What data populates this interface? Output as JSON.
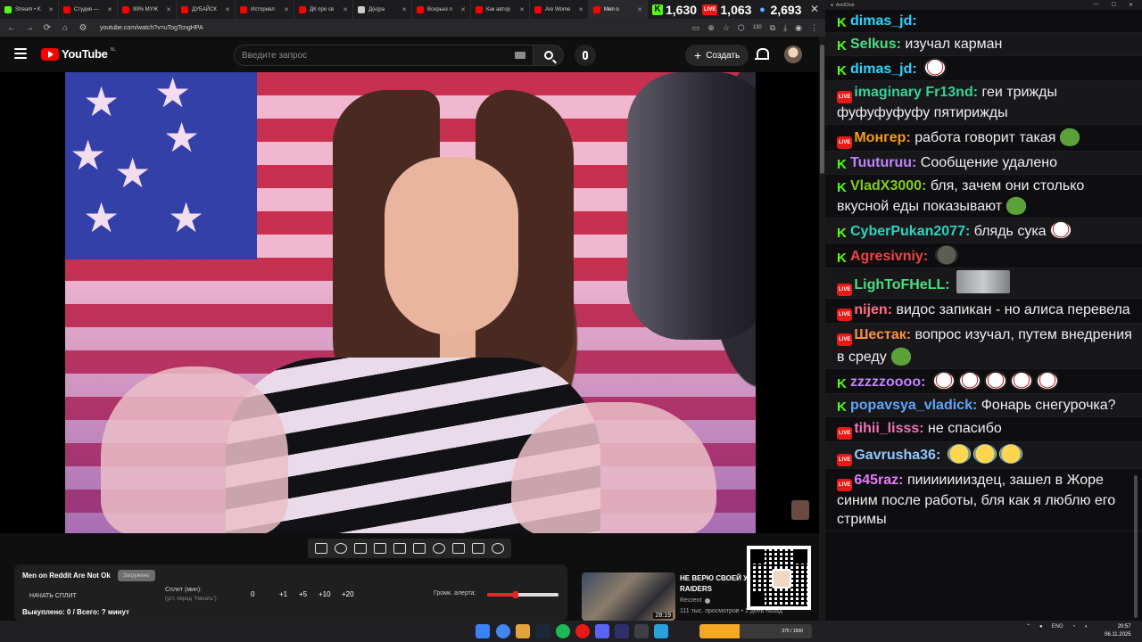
{
  "browser": {
    "tabs": [
      {
        "title": "Stream • K",
        "icon_color": "#53fc18"
      },
      {
        "title": "Студия —",
        "icon_color": "#ff0000"
      },
      {
        "title": "99% МУЖ",
        "icon_color": "#ff0000"
      },
      {
        "title": "ДУБАЙСК",
        "icon_color": "#ff0000"
      },
      {
        "title": "Историял",
        "icon_color": "#ff0000"
      },
      {
        "title": "ДК про св",
        "icon_color": "#ff0000"
      },
      {
        "title": "Д(н)ра",
        "icon_color": "#cccccc"
      },
      {
        "title": "Всерьез л",
        "icon_color": "#ff0000"
      },
      {
        "title": "Как автор",
        "icon_color": "#ff0000"
      },
      {
        "title": "Are Wome",
        "icon_color": "#ff0000"
      },
      {
        "title": "Men o",
        "icon_color": "#ff0000"
      }
    ],
    "url": "youtube.com/watch?v=uTogTcngHPA",
    "extension_badge": "130"
  },
  "stats": {
    "kick_viewers": "1,630",
    "live_viewers": "1,063",
    "total_viewers": "2,693",
    "live_label": "LIVE"
  },
  "youtube": {
    "logo_text": "YouTube",
    "region": "NL",
    "search_placeholder": "Введите запрос",
    "create_label": "Создать",
    "video_title": "Men on Reddit Are Not Ok",
    "video_badge": "Загружено",
    "split_button": "НАЧАТЬ СПЛИТ",
    "split_label": "Сплит (мин):",
    "split_hint": "(уст. перед \"Начать\")",
    "split_value": "0",
    "increments": [
      "+1",
      "+5",
      "+10",
      "+20"
    ],
    "alert_label": "Громк. алерта:",
    "alert_volume": 0.4,
    "paid_status": "Выкуплено: 0 / Всего: ? минут",
    "recommendation": {
      "title": "НЕ ВЕРЮ СВОЕЙ У RAIDERS",
      "channel": "Recrent",
      "meta": "111 тыс. просмотров • 1 день назад",
      "duration": "28:19"
    }
  },
  "chat": {
    "window_title": "AxelChat",
    "messages": [
      {
        "platform": "kick",
        "user": "dimas_jd",
        "color": "#2dd4ff",
        "text": "",
        "emotes": [
          "face"
        ]
      },
      {
        "platform": "kick",
        "user": "Selkus",
        "color": "#4ade80",
        "text": "изучал карман",
        "emotes": []
      },
      {
        "platform": "kick",
        "user": "dimas_jd",
        "color": "#2dd4ff",
        "text": "",
        "emotes": [
          "joker"
        ]
      },
      {
        "platform": "live",
        "user": "imaginary Fr13nd",
        "color": "#34d399",
        "text": "геи трижды фуфуфуфуфу пятирижды",
        "emotes": []
      },
      {
        "platform": "live",
        "user": "Монгер",
        "color": "#f59e0b",
        "text": "работа говорит такая",
        "emotes": [
          "pepe"
        ]
      },
      {
        "platform": "kick",
        "user": "Tuuturuu",
        "color": "#c084fc",
        "text": "Сообщение удалено",
        "emotes": []
      },
      {
        "platform": "kick",
        "user": "VladX3000",
        "color": "#84cc16",
        "text": "бля, зачем они столько вкусной еды показывают",
        "emotes": [
          "pepe"
        ]
      },
      {
        "platform": "kick",
        "user": "CyberPukan2077",
        "color": "#2dd4bf",
        "text": "блядь сука",
        "emotes": [
          "joker"
        ]
      },
      {
        "platform": "kick",
        "user": "Agresivniy",
        "color": "#ef4444",
        "text": "",
        "emotes": [
          "seal"
        ]
      },
      {
        "platform": "live",
        "user": "LighToFHeLL",
        "color": "#4ade80",
        "text": "",
        "emotes": [
          "rat"
        ]
      },
      {
        "platform": "live",
        "user": "nijen",
        "color": "#fb7185",
        "text": "видос запикан - но алиса перевела",
        "emotes": []
      },
      {
        "platform": "live",
        "user": "Шестак",
        "color": "#fb923c",
        "text": "вопрос изучал, путем внедрения в среду",
        "emotes": [
          "pepe"
        ]
      },
      {
        "platform": "kick",
        "user": "zzzzzoooo",
        "color": "#c084fc",
        "text": "",
        "emotes": [
          "joker",
          "joker",
          "joker",
          "joker",
          "joker"
        ]
      },
      {
        "platform": "kick",
        "user": "popavsya_vladick",
        "color": "#60a5fa",
        "text": "Фонарь снегурочка?",
        "emotes": []
      },
      {
        "platform": "live",
        "user": "tihii_lisss",
        "color": "#f472b6",
        "text": "не спасибо",
        "emotes": []
      },
      {
        "platform": "live",
        "user": "Gavrusha36",
        "color": "#93c5fd",
        "text": "",
        "emotes": [
          "laugh",
          "laugh",
          "laugh"
        ]
      },
      {
        "platform": "live",
        "user": "645raz",
        "color": "#e879f9",
        "text": "пиииииииздец, зашел в Жоре синим после работы, бля как я люблю его стримы",
        "emotes": []
      }
    ]
  },
  "taskbar": {
    "widget_text": "375 / 1500",
    "language": "ENG",
    "time": "20:57",
    "date": "06.11.2025"
  }
}
